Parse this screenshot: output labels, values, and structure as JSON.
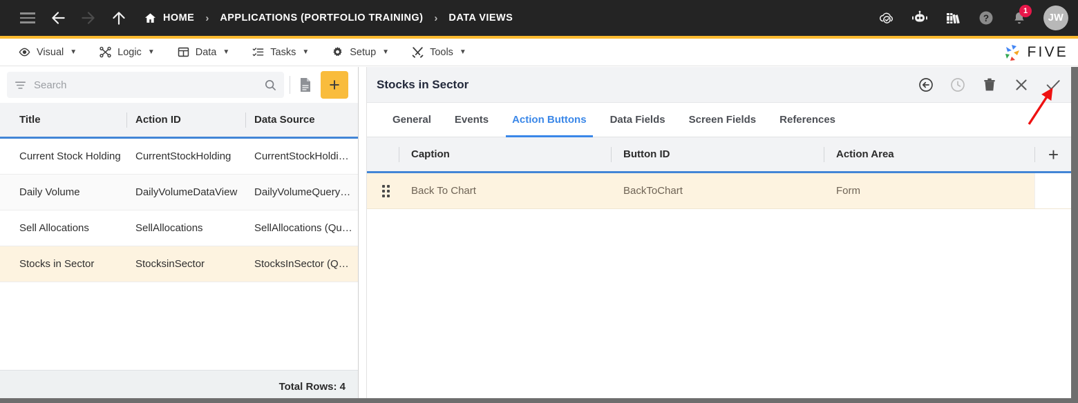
{
  "header": {
    "nav": {
      "menu_icon": "hamburger-icon",
      "back_icon": "arrow-left-icon",
      "forward_icon": "arrow-right-icon",
      "up_icon": "arrow-up-icon"
    },
    "breadcrumbs": [
      {
        "label": "HOME",
        "icon": "home-icon"
      },
      {
        "label": "APPLICATIONS (PORTFOLIO TRAINING)",
        "icon": ""
      },
      {
        "label": "DATA VIEWS",
        "icon": ""
      }
    ],
    "separator": "›",
    "actions": [
      {
        "name": "cloud-check-icon",
        "label": ""
      },
      {
        "name": "chat-bot-icon",
        "label": ""
      },
      {
        "name": "books-icon",
        "label": ""
      },
      {
        "name": "help-circle-icon",
        "label": ""
      },
      {
        "name": "bell-icon",
        "label": ""
      }
    ],
    "notification_count": "1",
    "avatar_initials": "JW",
    "accent_color": "#FBBA2F"
  },
  "menubar": {
    "items": [
      {
        "label": "Visual",
        "icon": "eye-icon",
        "caret": "▼"
      },
      {
        "label": "Logic",
        "icon": "logic-nodes-icon",
        "caret": "▼"
      },
      {
        "label": "Data",
        "icon": "table-grid-icon",
        "caret": "▼"
      },
      {
        "label": "Tasks",
        "icon": "checklist-icon",
        "caret": "▼"
      },
      {
        "label": "Setup",
        "icon": "gear-icon",
        "caret": "▼"
      },
      {
        "label": "Tools",
        "icon": "tools-icon",
        "caret": "▼"
      }
    ],
    "brand": "FIVE"
  },
  "left_panel": {
    "search": {
      "value": "",
      "placeholder": "Search",
      "filter_icon": "filter-icon",
      "search_icon": "search-icon"
    },
    "doc_button_icon": "document-icon",
    "add_button_label": "+",
    "columns": [
      "Title",
      "Action ID",
      "Data Source"
    ],
    "rows": [
      {
        "title": "Current Stock Holding",
        "action_id": "CurrentStockHolding",
        "data_source": "CurrentStockHoldin…"
      },
      {
        "title": "Daily Volume",
        "action_id": "DailyVolumeDataView",
        "data_source": "DailyVolumeQuery (…"
      },
      {
        "title": "Sell Allocations",
        "action_id": "SellAllocations",
        "data_source": "SellAllocations (Que…"
      },
      {
        "title": "Stocks in Sector",
        "action_id": "StocksinSector",
        "data_source": "StocksInSector (Que…"
      }
    ],
    "selected_row_index": 3,
    "footer": "Total Rows: 4"
  },
  "right_panel": {
    "title": "Stocks in Sector",
    "toolbar": [
      {
        "name": "back-circle-icon"
      },
      {
        "name": "history-clock-icon"
      },
      {
        "name": "delete-trash-icon"
      },
      {
        "name": "close-x-icon"
      },
      {
        "name": "save-check-icon"
      }
    ],
    "tabs": [
      {
        "label": "General",
        "active": false
      },
      {
        "label": "Events",
        "active": false
      },
      {
        "label": "Action Buttons",
        "active": true
      },
      {
        "label": "Data Fields",
        "active": false
      },
      {
        "label": "Screen Fields",
        "active": false
      },
      {
        "label": "References",
        "active": false
      }
    ],
    "columns": [
      "Caption",
      "Button ID",
      "Action Area"
    ],
    "add_row_label": "+",
    "rows": [
      {
        "caption": "Back To Chart",
        "button_id": "BackToChart",
        "action_area": "Form"
      }
    ]
  },
  "annotation": {
    "type": "arrow",
    "color": "#EE1111",
    "points_at": "save-check-icon"
  }
}
